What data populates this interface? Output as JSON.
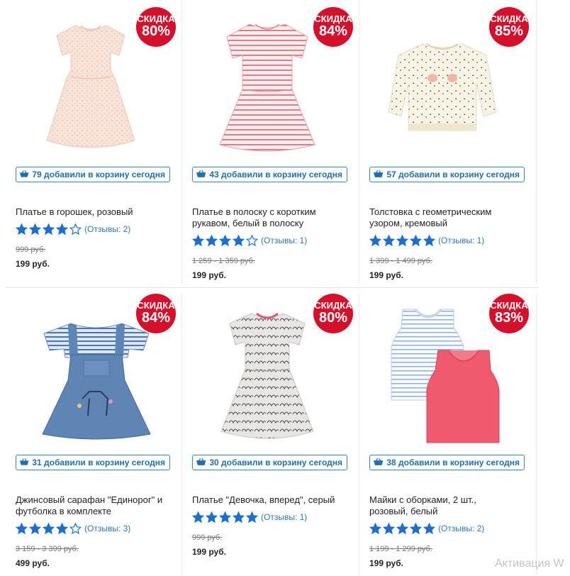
{
  "products": [
    {
      "badge_label": "СКИДКА",
      "discount": "80%",
      "image": "pink-polka-dot-dress",
      "cart_text": "79 добавили в корзину сегодня",
      "name": "Платье в горошек, розовый",
      "rating": 4,
      "reviews": "(Отзывы: 2)",
      "old_price": "999 руб.",
      "price": "199 руб."
    },
    {
      "badge_label": "СКИДКА",
      "discount": "84%",
      "image": "striped-dress",
      "cart_text": "43 добавили в корзину сегодня",
      "name": "Платье в полоску с коротким рукавом, белый в полоску",
      "rating": 4,
      "reviews": "(Отзывы: 1)",
      "old_price": "1 259 - 1 359 руб.",
      "price": "199 руб."
    },
    {
      "badge_label": "СКИДКА",
      "discount": "85%",
      "image": "cream-sweatshirt",
      "cart_text": "57 добавили в корзину сегодня",
      "name": "Толстовка с геометрическим узором, кремовый",
      "rating": 5,
      "reviews": "(Отзывы: 1)",
      "old_price": "1 399 - 1 499 руб.",
      "price": "199 руб."
    },
    {
      "badge_label": "СКИДКА",
      "discount": "84%",
      "image": "denim-pinafore",
      "cart_text": "31 добавили в корзину сегодня",
      "name": "Джинсовый сарафан \"Единорог\" и футболка в комплекте",
      "rating": 4,
      "reviews": "(Отзывы: 3)",
      "old_price": "3 159 - 3 399 руб.",
      "price": "499 руб."
    },
    {
      "badge_label": "СКИДКА",
      "discount": "80%",
      "image": "grey-print-dress",
      "cart_text": "30 добавили в корзину сегодня",
      "name": "Платье \"Девочка, вперед\", серый",
      "rating": 5,
      "reviews": "(Отзывы: 1)",
      "old_price": "999 руб.",
      "price": "199 руб."
    },
    {
      "badge_label": "СКИДКА",
      "discount": "83%",
      "image": "frill-vests-two-pack",
      "cart_text": "38 добавили в корзину сегодня",
      "name": "Майки с оборками, 2 шт., розовый, белый",
      "rating": 5,
      "reviews": "(Отзывы: 2)",
      "old_price": "1 199 - 1 299 руб.",
      "price": "199 руб."
    }
  ],
  "icons": {
    "cart": "basket-icon",
    "star_filled": "star-filled-icon",
    "star_empty": "star-outline-icon"
  },
  "colors": {
    "badge": "#d80f2b",
    "accent": "#1f6fb3",
    "star": "#1a6fd0"
  },
  "watermark": "Активация W"
}
